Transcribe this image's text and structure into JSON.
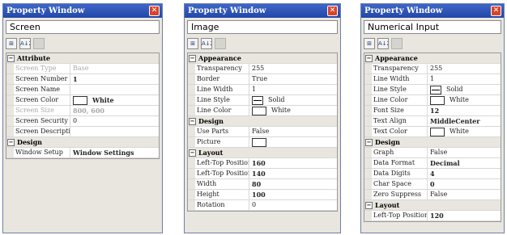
{
  "windows": [
    {
      "title": "Property Window",
      "object_name": "Screen",
      "name_col_width": 67,
      "sections": [
        {
          "label": "Attribute",
          "collapse": "−",
          "rows": [
            {
              "name": "Screen Type",
              "value": "Base",
              "dimmed": true
            },
            {
              "name": "Screen Number",
              "value": "1",
              "bold": true
            },
            {
              "name": "Screen Name",
              "value": ""
            },
            {
              "name": "Screen Color",
              "value": "White",
              "swatch": "color",
              "bold": true
            },
            {
              "name": "Screen Size",
              "value": "800, 600",
              "dimmed": true,
              "bold": true
            },
            {
              "name": "Screen Security",
              "value": "0"
            },
            {
              "name": "Screen Description",
              "value": ""
            }
          ]
        },
        {
          "label": "Design",
          "collapse": "−",
          "rows": [
            {
              "name": "Window Setup",
              "value": "Window Settings",
              "bold": true
            }
          ]
        }
      ]
    },
    {
      "title": "Property Window",
      "object_name": "Image",
      "name_col_width": 64,
      "sections": [
        {
          "label": "Appearance",
          "collapse": "−",
          "rows": [
            {
              "name": "Transparency",
              "value": "255"
            },
            {
              "name": "Border",
              "value": "True"
            },
            {
              "name": "Line Width",
              "value": "1"
            },
            {
              "name": "Line Style",
              "value": "Solid",
              "swatch": "line"
            },
            {
              "name": "Line Color",
              "value": "White",
              "swatch": "color"
            }
          ]
        },
        {
          "label": "Design",
          "collapse": "−",
          "rows": [
            {
              "name": "Use Parts",
              "value": "False"
            },
            {
              "name": "Picture",
              "value": "",
              "swatch": "color"
            }
          ]
        },
        {
          "label": "Layout",
          "collapse": "−",
          "rows": [
            {
              "name": "Left-Top Position X",
              "value": "160",
              "bold": true
            },
            {
              "name": "Left-Top Position Y",
              "value": "140",
              "bold": true
            },
            {
              "name": "Width",
              "value": "80",
              "bold": true
            },
            {
              "name": "Height",
              "value": "100",
              "bold": true
            },
            {
              "name": "Rotation",
              "value": "0"
            }
          ]
        }
      ]
    },
    {
      "title": "Property Window",
      "object_name": "Numerical Input",
      "name_col_width": 66,
      "sections": [
        {
          "label": "Appearance",
          "collapse": "−",
          "rows": [
            {
              "name": "Transparency",
              "value": "255"
            },
            {
              "name": "Line Width",
              "value": "1"
            },
            {
              "name": "Line Style",
              "value": "Solid",
              "swatch": "line"
            },
            {
              "name": "Line Color",
              "value": "White",
              "swatch": "color"
            },
            {
              "name": "Font Size",
              "value": "12",
              "bold": true
            },
            {
              "name": "Text Align",
              "value": "MiddleCenter",
              "bold": true
            },
            {
              "name": "Text Color",
              "value": "White",
              "swatch": "color"
            }
          ]
        },
        {
          "label": "Design",
          "collapse": "−",
          "rows": [
            {
              "name": "Graph",
              "value": "False"
            },
            {
              "name": "Data Format",
              "value": "Decimal",
              "bold": true
            },
            {
              "name": "Data Digits",
              "value": "4",
              "bold": true
            },
            {
              "name": "Char Space",
              "value": "0",
              "bold": true
            },
            {
              "name": "Zero Suppress",
              "value": "False"
            }
          ]
        },
        {
          "label": "Layout",
          "collapse": "−",
          "rows": [
            {
              "name": "Left-Top Position X",
              "value": "120",
              "bold": true
            }
          ]
        }
      ]
    }
  ],
  "toolbar_icons": [
    "categorized-icon",
    "sort-alphabetical-icon",
    "property-pages-icon"
  ],
  "toolbar_glyphs": [
    "⊞",
    "A↓Z",
    ""
  ],
  "close_glyph": "✕"
}
